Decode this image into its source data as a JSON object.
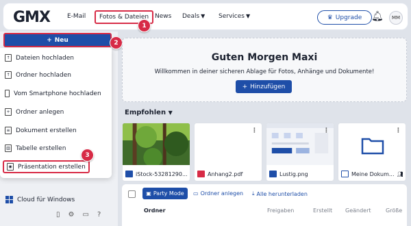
{
  "header": {
    "logo": "GMX",
    "nav": [
      {
        "label": "E-Mail"
      },
      {
        "label": "Fotos & Dateien"
      },
      {
        "label": "News"
      },
      {
        "label": "Deals"
      },
      {
        "label": "Services"
      }
    ],
    "upgrade_label": "Upgrade",
    "avatar_initials": "MM"
  },
  "badges": [
    "1",
    "2",
    "3"
  ],
  "sidebar": {
    "new_label": "Neu",
    "menu": [
      {
        "label": "Dateien hochladen",
        "icon": "upload-file-icon"
      },
      {
        "label": "Ordner hochladen",
        "icon": "upload-folder-icon"
      },
      {
        "label": "Vom Smartphone hochladen",
        "icon": "smartphone-icon"
      },
      {
        "label": "Ordner anlegen",
        "icon": "new-folder-icon"
      },
      {
        "label": "Dokument erstellen",
        "icon": "document-icon"
      },
      {
        "label": "Tabelle erstellen",
        "icon": "spreadsheet-icon"
      },
      {
        "label": "Präsentation erstellen",
        "icon": "presentation-icon"
      }
    ],
    "cloud_label": "Cloud für Windows"
  },
  "banner": {
    "title": "Guten Morgen Maxi",
    "subtitle": "Willkommen in deiner sicheren Ablage für Fotos, Anhänge und Dokumente!",
    "add_label": "Hinzufügen"
  },
  "recommended": {
    "title": "Empfohlen",
    "cards": [
      {
        "name": "iStock-53281290...",
        "type": "image"
      },
      {
        "name": "Anhang2.pdf",
        "type": "pdf"
      },
      {
        "name": "Lustig.png",
        "type": "image"
      },
      {
        "name": "Meine Dokum...",
        "type": "folder"
      }
    ]
  },
  "list": {
    "party_label": "Party Mode",
    "new_folder_label": "Ordner anlegen",
    "download_all_label": "Alle herunterladen",
    "columns": [
      "Ordner",
      "Freigaben",
      "Erstellt",
      "Geändert",
      "Größe"
    ]
  },
  "colors": {
    "brand": "#1e4ea8",
    "highlight": "#d72b46"
  }
}
